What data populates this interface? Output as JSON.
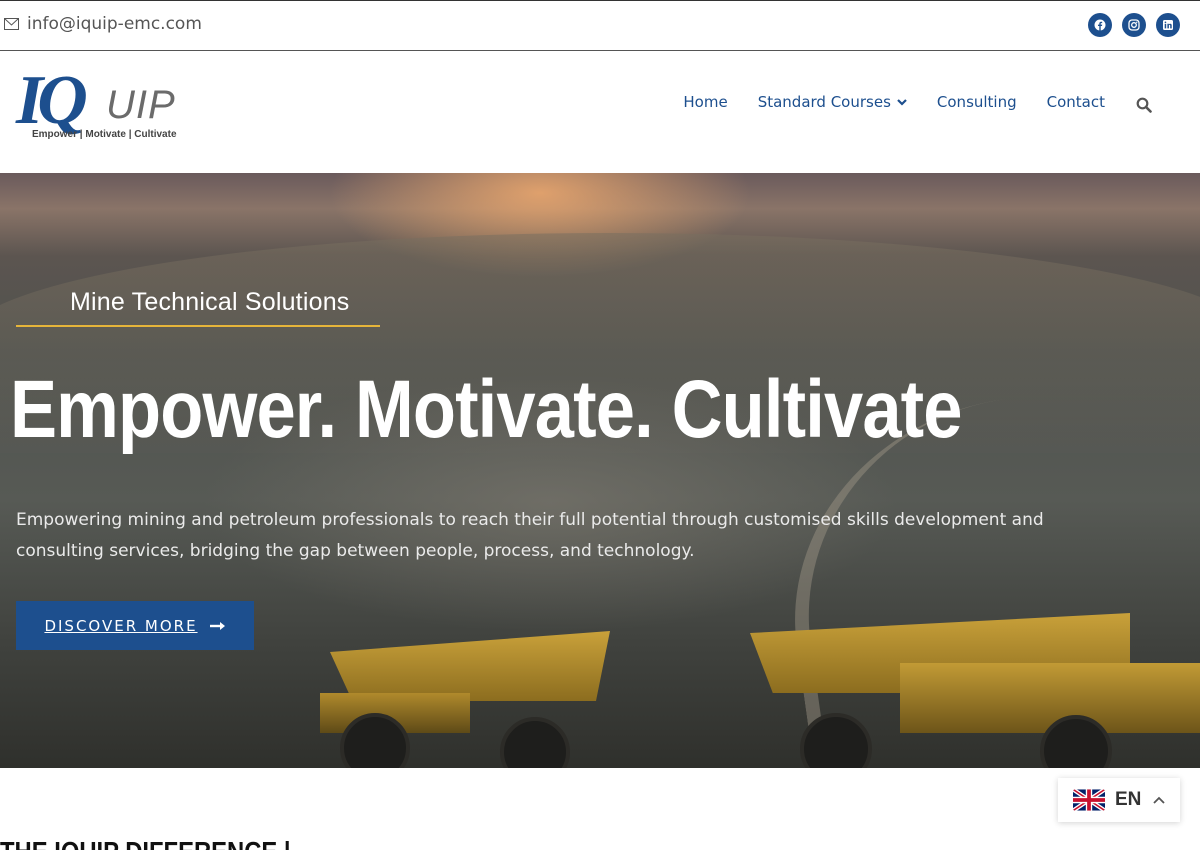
{
  "topbar": {
    "email": "info@iquip-emc.com",
    "socials": [
      {
        "icon": "facebook-icon"
      },
      {
        "icon": "instagram-icon"
      },
      {
        "icon": "linkedin-icon"
      }
    ]
  },
  "header": {
    "logo": {
      "primary": "IQ",
      "secondary": "UIP",
      "tagline": "Empower | Motivate | Cultivate"
    },
    "nav": [
      {
        "label": "Home"
      },
      {
        "label": "Standard Courses",
        "has_dropdown": true
      },
      {
        "label": "Consulting"
      },
      {
        "label": "Contact"
      }
    ],
    "search_icon": "search-icon"
  },
  "hero": {
    "subtitle": "Mine Technical Solutions",
    "headline": "Empower. Motivate. Cultivate",
    "lead": "Empowering mining and petroleum professionals to reach their full potential through customised skills development and consulting services, bridging the gap between people, process, and technology.",
    "cta_label": "DISCOVER MORE",
    "cta_icon": "arrow-right-icon"
  },
  "section": {
    "title": "THE IQUIP DIFFERENCE |"
  },
  "language": {
    "code": "EN",
    "flag_icon": "uk-flag-icon",
    "caret_icon": "chevron-up-icon"
  },
  "colors": {
    "brand_blue": "#1d4f8e",
    "accent_gold": "#e6b53a",
    "logo_gray": "#6b6b6b"
  }
}
